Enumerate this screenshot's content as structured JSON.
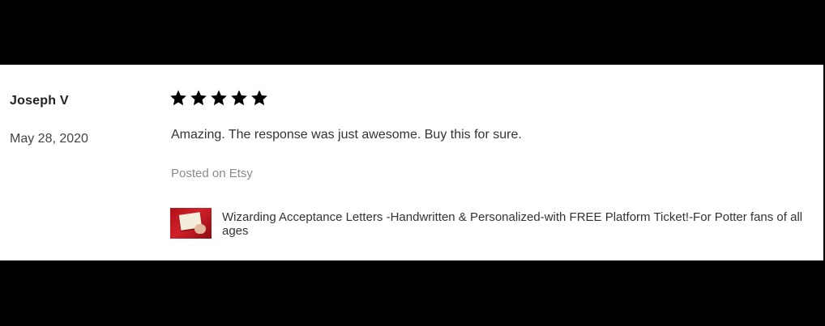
{
  "review": {
    "reviewer_name": "Joseph V",
    "date": "May 28, 2020",
    "rating": 5,
    "rating_max": 5,
    "text": "Amazing. The response was just awesome. Buy this for sure.",
    "source": "Posted on Etsy",
    "listing": {
      "thumbnail_icon": "product-thumbnail",
      "title": "Wizarding Acceptance Letters -Handwritten & Personalized-with FREE Platform Ticket!-For Potter fans of all ages"
    }
  },
  "colors": {
    "background_bars": "#000000",
    "card_background": "#ffffff",
    "star": "#000000",
    "muted_text": "#8a8a8a"
  }
}
